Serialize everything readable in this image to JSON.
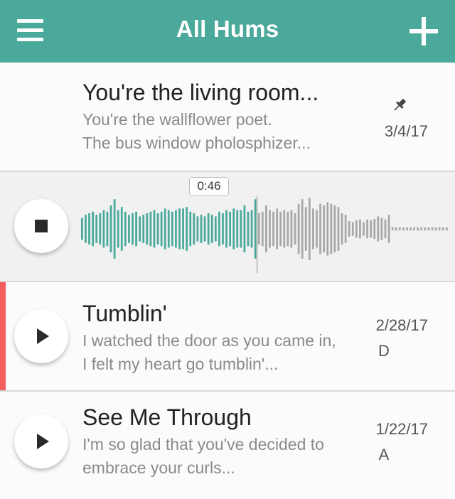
{
  "header": {
    "title": "All Hums"
  },
  "colors": {
    "brand": "#4aa99b",
    "accent": "#f25d5d",
    "wave_played": "#4aa99b",
    "wave_unplayed": "#a8a8a8"
  },
  "icons": {
    "menu": "hamburger-icon",
    "add": "plus-icon",
    "pin": "pin-icon",
    "stop": "stop-icon",
    "play": "play-icon"
  },
  "songs": [
    {
      "title": "You're the living room...",
      "line1": "You're the wallflower poet.",
      "line2": "The bus window pholosphizer...",
      "date": "3/4/17",
      "pinned": true
    },
    {
      "title": "Tumblin'",
      "line1": "I watched the door as you came in,",
      "line2": "I felt my heart go tumblin'...",
      "date": "2/28/17",
      "key": "D",
      "selected": true
    },
    {
      "title": "See Me Through",
      "line1": "I'm so glad that you've decided to",
      "line2": "embrace your curls...",
      "date": "1/22/17",
      "key": "A"
    }
  ],
  "player": {
    "time": "0:46",
    "progress": 0.48,
    "amplitudes": [
      0.35,
      0.45,
      0.5,
      0.55,
      0.45,
      0.5,
      0.6,
      0.55,
      0.75,
      0.95,
      0.6,
      0.7,
      0.55,
      0.45,
      0.5,
      0.55,
      0.4,
      0.45,
      0.5,
      0.55,
      0.6,
      0.5,
      0.55,
      0.65,
      0.6,
      0.55,
      0.6,
      0.65,
      0.65,
      0.7,
      0.55,
      0.5,
      0.4,
      0.45,
      0.4,
      0.5,
      0.45,
      0.4,
      0.55,
      0.5,
      0.6,
      0.55,
      0.65,
      0.6,
      0.6,
      0.75,
      0.55,
      0.6,
      0.95,
      0.5,
      0.55,
      0.75,
      0.6,
      0.55,
      0.65,
      0.55,
      0.6,
      0.55,
      0.6,
      0.5,
      0.8,
      0.95,
      0.7,
      1.0,
      0.65,
      0.6,
      0.8,
      0.75,
      0.85,
      0.8,
      0.75,
      0.7,
      0.5,
      0.45,
      0.25,
      0.22,
      0.28,
      0.3,
      0.22,
      0.3,
      0.28,
      0.32,
      0.4,
      0.35,
      0.3,
      0.45,
      0.05,
      0.05,
      0.05,
      0.05,
      0.05,
      0.05,
      0.05,
      0.05,
      0.05,
      0.05,
      0.05,
      0.05,
      0.05,
      0.05,
      0.05,
      0.05
    ]
  }
}
